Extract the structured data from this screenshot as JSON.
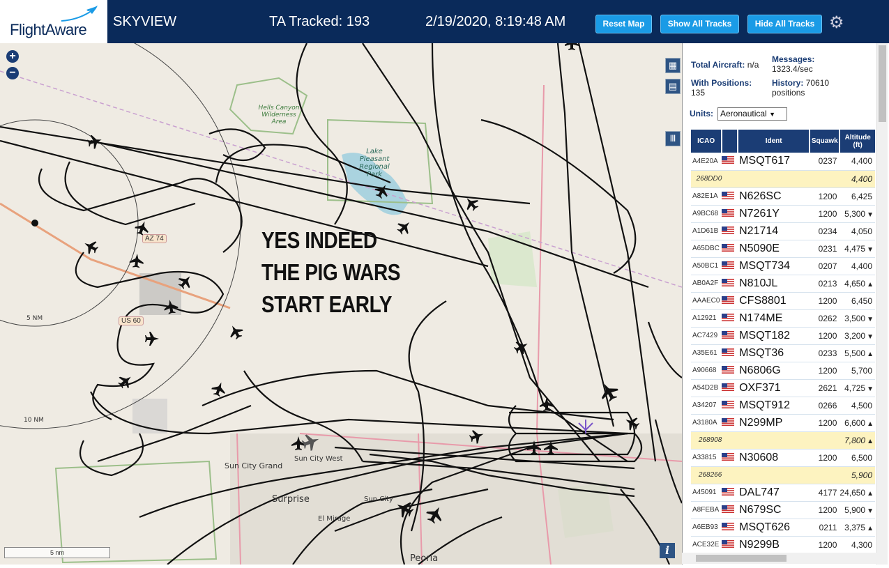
{
  "header": {
    "logo": "FlightAware",
    "app_name": "SKYVIEW",
    "tracked": "TA Tracked: 193",
    "datetime": "2/19/2020, 8:19:48 AM",
    "buttons": {
      "reset": "Reset Map",
      "show_all": "Show All Tracks",
      "hide_all": "Hide All Tracks"
    }
  },
  "map": {
    "overlay_text": [
      "YES INDEED",
      "THE PIG WARS",
      "START EARLY"
    ],
    "labels": {
      "hells_canyon": "Hells Canyon Wilderness Area",
      "lake": "Lake Pleasant Regional Park",
      "sun_city_grand": "Sun City Grand",
      "sun_city_west": "Sun City West",
      "surprise": "Surprise",
      "el_mirage": "El Mirage",
      "sun_city": "Sun City",
      "peoria": "Peoria",
      "ring_5": "5 NM",
      "ring_10": "10 NM",
      "az74": "AZ 74",
      "us60": "US 60"
    },
    "scale": "5 nm",
    "zoom_in": "+",
    "zoom_out": "−"
  },
  "stats": {
    "total_label": "Total Aircraft:",
    "total_value": "n/a",
    "messages_label": "Messages:",
    "messages_value": "1323.4/sec",
    "positions_label": "With Positions:",
    "positions_value": "135",
    "history_label": "History:",
    "history_value": "70610 positions"
  },
  "units": {
    "label": "Units:",
    "value": "Aeronautical"
  },
  "table": {
    "headers": [
      "ICAO",
      "",
      "Ident",
      "Squawk",
      "Altitude (ft)"
    ],
    "rows": [
      {
        "icao": "A4E20A",
        "flag": true,
        "ident": "MSQT617",
        "squawk": "0237",
        "alt": "4,400",
        "trend": "",
        "mlat": false
      },
      {
        "icao": "268DD0",
        "flag": false,
        "ident": "",
        "squawk": "",
        "alt": "4,400",
        "trend": "",
        "mlat": true
      },
      {
        "icao": "A82E1A",
        "flag": true,
        "ident": "N626SC",
        "squawk": "1200",
        "alt": "6,425",
        "trend": "",
        "mlat": false
      },
      {
        "icao": "A9BC68",
        "flag": true,
        "ident": "N7261Y",
        "squawk": "1200",
        "alt": "5,300",
        "trend": "▼",
        "mlat": false
      },
      {
        "icao": "A1D61B",
        "flag": true,
        "ident": "N21714",
        "squawk": "0234",
        "alt": "4,050",
        "trend": "",
        "mlat": false
      },
      {
        "icao": "A65DBC",
        "flag": true,
        "ident": "N5090E",
        "squawk": "0231",
        "alt": "4,475",
        "trend": "▼",
        "mlat": false
      },
      {
        "icao": "A50BC1",
        "flag": true,
        "ident": "MSQT734",
        "squawk": "0207",
        "alt": "4,400",
        "trend": "",
        "mlat": false
      },
      {
        "icao": "AB0A2F",
        "flag": true,
        "ident": "N810JL",
        "squawk": "0213",
        "alt": "4,650",
        "trend": "▲",
        "mlat": false
      },
      {
        "icao": "AAAEC0",
        "flag": true,
        "ident": "CFS8801",
        "squawk": "1200",
        "alt": "6,450",
        "trend": "",
        "mlat": false
      },
      {
        "icao": "A12921",
        "flag": true,
        "ident": "N174ME",
        "squawk": "0262",
        "alt": "3,500",
        "trend": "▼",
        "mlat": false
      },
      {
        "icao": "AC7429",
        "flag": true,
        "ident": "MSQT182",
        "squawk": "1200",
        "alt": "3,200",
        "trend": "▼",
        "mlat": false
      },
      {
        "icao": "A35E61",
        "flag": true,
        "ident": "MSQT36",
        "squawk": "0233",
        "alt": "5,500",
        "trend": "▲",
        "mlat": false
      },
      {
        "icao": "A90668",
        "flag": true,
        "ident": "N6806G",
        "squawk": "1200",
        "alt": "5,700",
        "trend": "",
        "mlat": false
      },
      {
        "icao": "A54D2B",
        "flag": true,
        "ident": "OXF371",
        "squawk": "2621",
        "alt": "4,725",
        "trend": "▼",
        "mlat": false
      },
      {
        "icao": "A34207",
        "flag": true,
        "ident": "MSQT912",
        "squawk": "0266",
        "alt": "4,500",
        "trend": "",
        "mlat": false
      },
      {
        "icao": "A3180A",
        "flag": true,
        "ident": "N299MP",
        "squawk": "1200",
        "alt": "6,600",
        "trend": "▲",
        "mlat": false
      },
      {
        "icao": "268908",
        "flag": false,
        "ident": "",
        "squawk": "",
        "alt": "7,800",
        "trend": "▲",
        "mlat": true
      },
      {
        "icao": "A33815",
        "flag": true,
        "ident": "N30608",
        "squawk": "1200",
        "alt": "6,500",
        "trend": "",
        "mlat": false
      },
      {
        "icao": "268266",
        "flag": false,
        "ident": "",
        "squawk": "",
        "alt": "5,900",
        "trend": "",
        "mlat": true
      },
      {
        "icao": "A45091",
        "flag": true,
        "ident": "DAL747",
        "squawk": "4177",
        "alt": "24,650",
        "trend": "▲",
        "mlat": false
      },
      {
        "icao": "A8FEBA",
        "flag": true,
        "ident": "N679SC",
        "squawk": "1200",
        "alt": "5,900",
        "trend": "▼",
        "mlat": false
      },
      {
        "icao": "A6EB93",
        "flag": true,
        "ident": "MSQT626",
        "squawk": "0211",
        "alt": "3,375",
        "trend": "▲",
        "mlat": false
      },
      {
        "icao": "ACE32E",
        "flag": true,
        "ident": "N9299B",
        "squawk": "1200",
        "alt": "4,300",
        "trend": "",
        "mlat": false
      }
    ]
  },
  "colors": {
    "header_bg": "#0a2a5a",
    "button": "#1a9be6",
    "table_header": "#1b3d75",
    "mlat_row": "#fdf3c0"
  }
}
